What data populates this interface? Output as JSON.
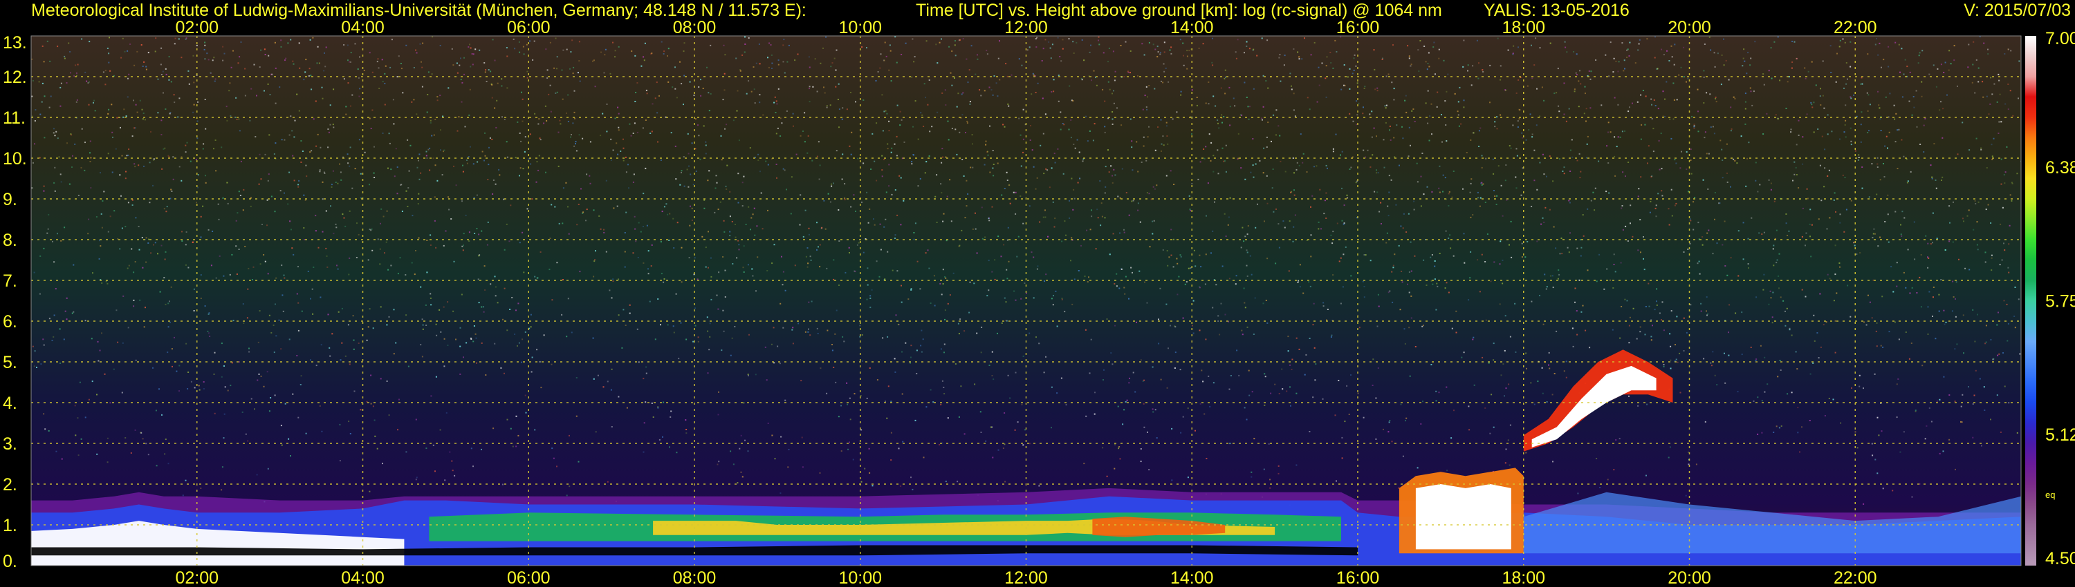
{
  "header": {
    "institute": "Meteorological Institute of Ludwig-Maximilians-Universität (München, Germany; 48.148 N / 11.573 E):",
    "axes_desc": "Time [UTC] vs. Height above ground [km]: log (rc-signal) @ 1064 nm",
    "instrument": "YALIS: 13-05-2016",
    "version": "V: 2015/07/03"
  },
  "chart_data": {
    "type": "heatmap",
    "title": "Time [UTC] vs. Height above ground [km]: log (rc-signal) @ 1064 nm",
    "x_ticks": [
      "02:00",
      "04:00",
      "06:00",
      "08:00",
      "10:00",
      "12:00",
      "14:00",
      "16:00",
      "18:00",
      "20:00",
      "22:00"
    ],
    "x_range_hours": [
      0,
      24
    ],
    "y_ticks": [
      0,
      1,
      2,
      3,
      4,
      5,
      6,
      7,
      8,
      9,
      10,
      11,
      12,
      13
    ],
    "y_tick_labels": [
      "0.",
      "1.",
      "2.",
      "3.",
      "4.",
      "5.",
      "6.",
      "7.",
      "8.",
      "9.",
      "10.",
      "11.",
      "12.",
      "13."
    ],
    "ylim": [
      0,
      13
    ],
    "grid": true,
    "colorbar": {
      "range": [
        4.5,
        7.0
      ],
      "tick_labels": [
        "7.00",
        "6.38",
        "5.75",
        "5.12",
        "4.50"
      ],
      "tick_values": [
        7.0,
        6.38,
        5.75,
        5.12,
        4.5
      ],
      "note": "eq",
      "colors": [
        "#b89ab8",
        "#a882a8",
        "#9a6a9a",
        "#8a4a8a",
        "#7a2a8a",
        "#6a1a9a",
        "#4a1aaa",
        "#2a2ad0",
        "#1a4af0",
        "#2a6af8",
        "#4a8af8",
        "#6aaaf8",
        "#4ac0d0",
        "#3ad0a0",
        "#1ab060",
        "#1ac040",
        "#3ae030",
        "#8aea2a",
        "#d0f020",
        "#f8e020",
        "#f8b010",
        "#f87a10",
        "#f03010",
        "#e01010",
        "#f0a0a0",
        "#f0d0d0",
        "#ffffff"
      ]
    },
    "features": [
      {
        "name": "boundary-layer-aerosol",
        "time_hours": [
          0.0,
          24.0
        ],
        "height_km": [
          0.0,
          1.3
        ]
      },
      {
        "name": "low-cloud",
        "time_hours": [
          16.6,
          17.9
        ],
        "height_km": [
          0.3,
          2.2
        ]
      },
      {
        "name": "mid-cloud",
        "time_hours": [
          18.0,
          19.9
        ],
        "height_km": [
          2.8,
          5.3
        ]
      }
    ]
  }
}
